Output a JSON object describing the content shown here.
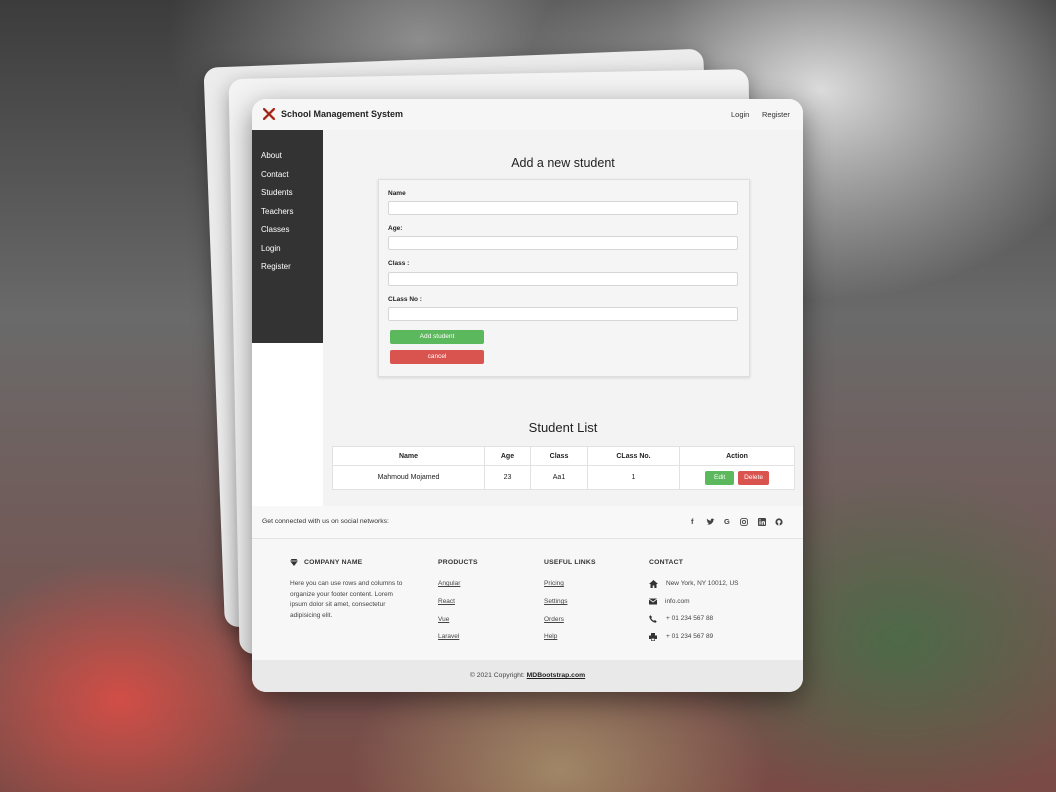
{
  "navbar": {
    "brand": "School Management System",
    "login": "Login",
    "register": "Register",
    "brand_color": "#c0392b"
  },
  "sidebar": {
    "items": [
      "About",
      "Contact",
      "Students",
      "Teachers",
      "Classes",
      "Login",
      "Register"
    ]
  },
  "form": {
    "title": "Add a new student",
    "fields": [
      {
        "label": "Name",
        "value": ""
      },
      {
        "label": "Age:",
        "value": ""
      },
      {
        "label": "Class :",
        "value": ""
      },
      {
        "label": "CLass No :",
        "value": ""
      }
    ],
    "submit_label": "Add student",
    "cancel_label": "cancel"
  },
  "student_list": {
    "title": "Student List",
    "columns": [
      "Name",
      "Age",
      "Class",
      "CLass No.",
      "Action"
    ],
    "rows": [
      {
        "name": "Mahmoud Mojamed",
        "age": "23",
        "class": "Aa1",
        "class_no": "1"
      }
    ],
    "edit_label": "Edit",
    "delete_label": "Delete"
  },
  "footer": {
    "social_text": "Get connected with us on social networks:",
    "social_icons": [
      "facebook-icon",
      "twitter-icon",
      "google-icon",
      "instagram-icon",
      "linkedin-icon",
      "github-icon"
    ],
    "company": {
      "title": "COMPANY NAME",
      "text": "Here you can use rows and columns to organize your footer content. Lorem ipsum dolor sit amet, consectetur adipisicing elit."
    },
    "products": {
      "title": "PRODUCTS",
      "links": [
        "Angular",
        "React",
        "Vue",
        "Laravel"
      ]
    },
    "useful_links": {
      "title": "USEFUL LINKS",
      "links": [
        "Pricing",
        "Settings",
        "Orders",
        "Help"
      ]
    },
    "contact": {
      "title": "CONTACT",
      "items": [
        "New York, NY 10012, US",
        "info.com",
        "+ 01 234 567 88",
        "+ 01 234 567 89"
      ]
    },
    "copyright_prefix": "© 2021 Copyright:",
    "copyright_link": "MDBootstrap.com"
  },
  "colors": {
    "success": "#5cb85c",
    "danger": "#d9534f",
    "sidebar": "#333333"
  }
}
